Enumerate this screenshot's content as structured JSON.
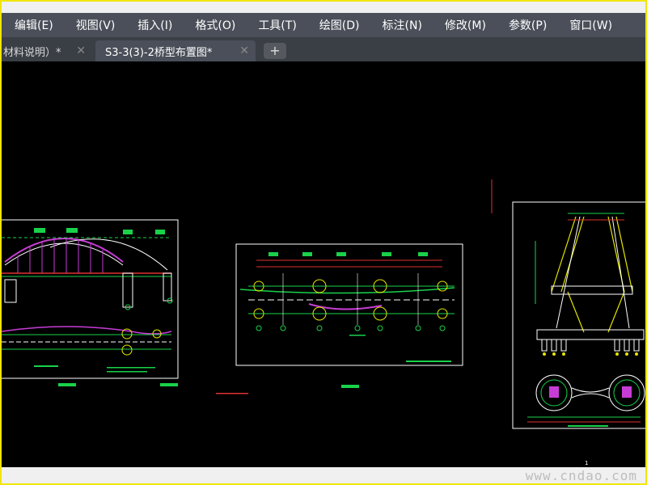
{
  "menu": {
    "items": [
      "编辑(E)",
      "视图(V)",
      "插入(I)",
      "格式(O)",
      "工具(T)",
      "绘图(D)",
      "标注(N)",
      "修改(M)",
      "参数(P)",
      "窗口(W)"
    ]
  },
  "tabs": {
    "items": [
      {
        "label": "材料说明）*",
        "close": "✕"
      },
      {
        "label": "S3-3(3)-2桥型布置图*",
        "close": "✕"
      }
    ],
    "add": "+"
  },
  "canvas": {
    "page_number": "1"
  },
  "status": {
    "watermark": "www.cndao.com"
  },
  "colors": {
    "frame": "#f2e600",
    "menubar": "#4a4f59",
    "tabbar": "#3a3e45",
    "canvas": "#000000",
    "drawing_green": "#19d24a",
    "drawing_magenta": "#c83cd6",
    "drawing_red": "#e03030",
    "drawing_yellow": "#e6e600"
  },
  "icons": {
    "tab_close": "close-icon",
    "tab_add": "plus-icon"
  }
}
